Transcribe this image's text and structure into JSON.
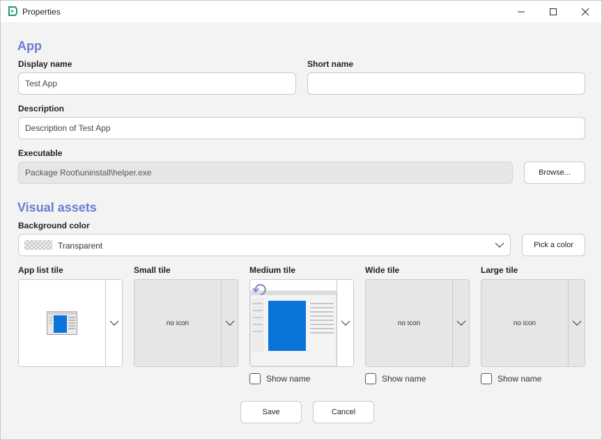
{
  "window": {
    "title": "Properties"
  },
  "app_section": {
    "heading": "App",
    "display_name_label": "Display name",
    "display_name_value": "Test App",
    "short_name_label": "Short name",
    "short_name_value": "",
    "description_label": "Description",
    "description_value": "Description of Test App",
    "executable_label": "Executable",
    "executable_value": "Package Root\\uninstall\\helper.exe",
    "browse_label": "Browse..."
  },
  "visual_assets": {
    "heading": "Visual assets",
    "bg_color_label": "Background color",
    "bg_color_value": "Transparent",
    "pick_color_label": "Pick a color",
    "tiles": [
      {
        "label": "App list tile",
        "content": "",
        "show_name": null
      },
      {
        "label": "Small tile",
        "content": "no icon",
        "show_name": null
      },
      {
        "label": "Medium tile",
        "content": "",
        "show_name": "Show name"
      },
      {
        "label": "Wide tile",
        "content": "no icon",
        "show_name": "Show name"
      },
      {
        "label": "Large tile",
        "content": "no icon",
        "show_name": "Show name"
      }
    ]
  },
  "footer": {
    "save_label": "Save",
    "cancel_label": "Cancel"
  },
  "colors": {
    "accent": "#6b7bd3",
    "app_icon": "#1e9b6a",
    "tile_blue": "#0a74da"
  },
  "icons": [
    "app-logo-icon",
    "minimize-icon",
    "maximize-icon",
    "close-icon",
    "chevron-down-icon",
    "refresh-icon"
  ]
}
